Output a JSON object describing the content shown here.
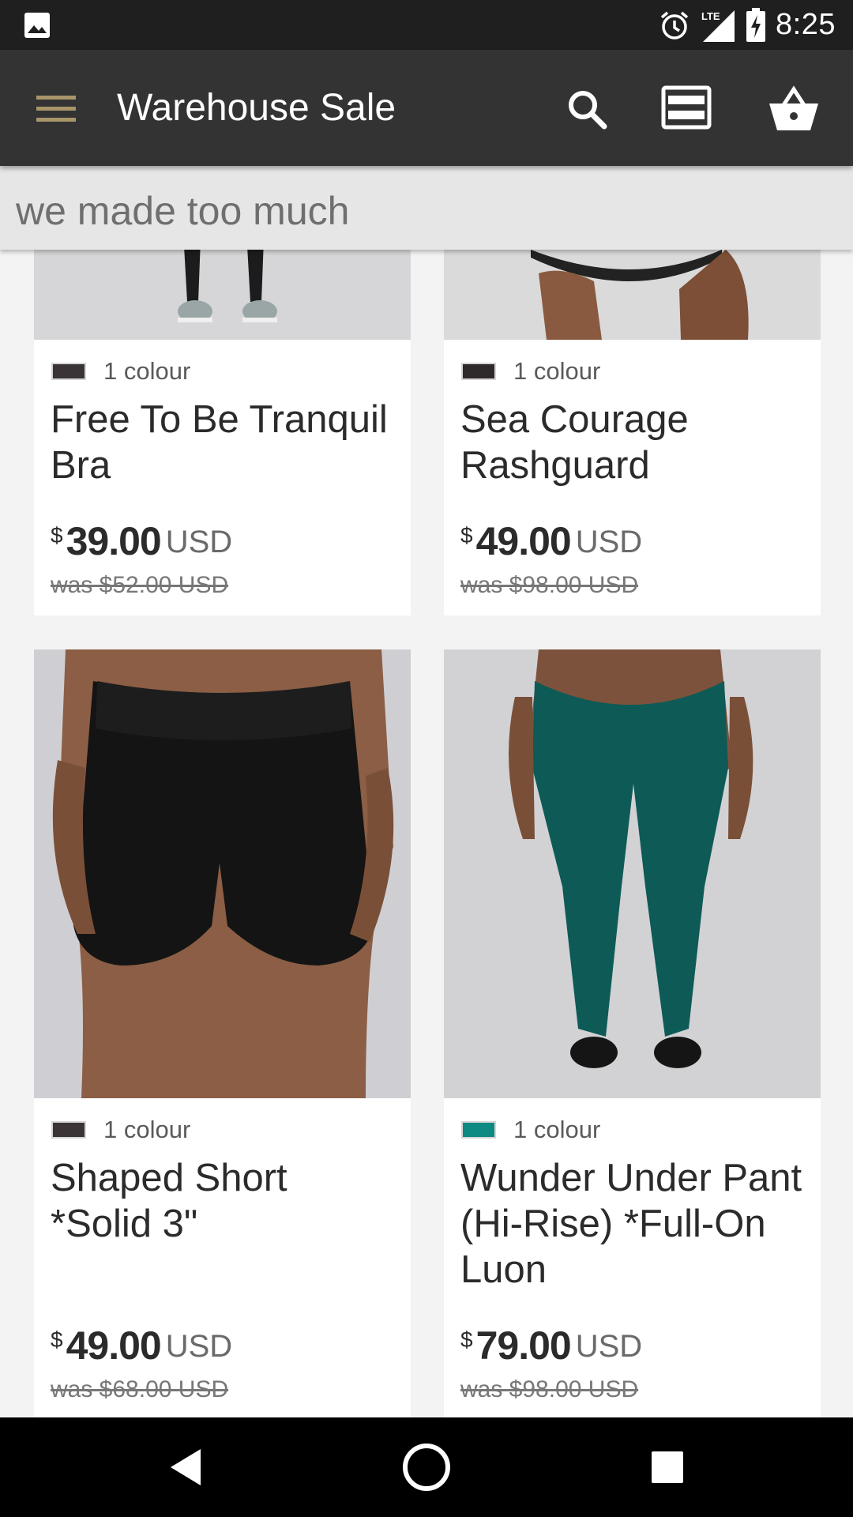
{
  "status_bar": {
    "time": "8:25",
    "icons": [
      "image-icon",
      "alarm-icon",
      "lte-signal-icon",
      "battery-charging-icon"
    ],
    "network": "LTE"
  },
  "toolbar": {
    "title": "Warehouse Sale",
    "icons": [
      "menu-icon",
      "search-icon",
      "view-toggle-icon",
      "basket-icon"
    ]
  },
  "subheader": {
    "tagline": "we made too much"
  },
  "products": [
    {
      "colour_count": "1 colour",
      "swatch": "#3a3436",
      "name": "Free To Be Tranquil Bra",
      "currency_symbol": "$",
      "price": "39.00",
      "currency": "USD",
      "was": "was $52.00 USD"
    },
    {
      "colour_count": "1 colour",
      "swatch": "#2e2a2c",
      "name": "Sea Courage Rashguard",
      "currency_symbol": "$",
      "price": "49.00",
      "currency": "USD",
      "was": "was $98.00 USD"
    },
    {
      "colour_count": "1 colour",
      "swatch": "#3a3436",
      "name": "Shaped Short *Solid 3\"",
      "currency_symbol": "$",
      "price": "49.00",
      "currency": "USD",
      "was": "was $68.00 USD"
    },
    {
      "colour_count": "1 colour",
      "swatch": "#0f8a82",
      "name": "Wunder Under Pant (Hi-Rise) *Full-On Luon",
      "currency_symbol": "$",
      "price": "79.00",
      "currency": "USD",
      "was": "was $98.00 USD"
    }
  ],
  "nav_bar": {
    "icons": [
      "back-icon",
      "home-icon",
      "recents-icon"
    ]
  },
  "colors": {
    "toolbar_bg": "#333333",
    "menu_accent": "#a8956a",
    "status_bg": "#1f1f1f",
    "page_bg": "#f3f3f3"
  }
}
